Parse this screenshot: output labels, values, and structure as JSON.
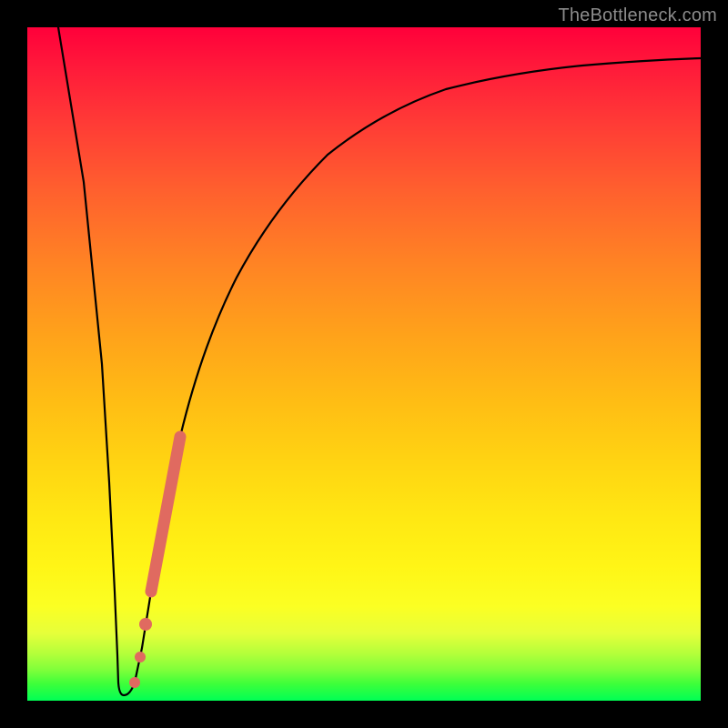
{
  "attribution": "TheBottleneck.com",
  "colors": {
    "frame": "#000000",
    "curve": "#000000",
    "marker": "#e06a60",
    "gradient_top": "#ff003a",
    "gradient_bottom": "#00ff55",
    "attribution_text": "#8c8c8c"
  },
  "chart_data": {
    "type": "line",
    "title": "",
    "xlabel": "",
    "ylabel": "",
    "xlim": [
      0,
      100
    ],
    "ylim": [
      0,
      100
    ],
    "x": [
      5,
      6,
      7,
      8,
      9,
      10,
      11,
      12,
      12.5,
      13,
      13.5,
      14,
      15,
      16,
      17,
      18,
      19,
      20,
      22,
      24,
      26,
      28,
      30,
      33,
      36,
      40,
      45,
      50,
      55,
      60,
      66,
      73,
      80,
      88,
      100
    ],
    "y": [
      100,
      92,
      80,
      68,
      55,
      40,
      25,
      10,
      5,
      2,
      1,
      2,
      6,
      12,
      18,
      24,
      30,
      36,
      46,
      55,
      62,
      68,
      72,
      77,
      80,
      83,
      86,
      88,
      89.5,
      90.7,
      91.8,
      92.8,
      93.6,
      94.4,
      95.3
    ],
    "markers": [
      {
        "x": 14.0,
        "y": 2
      },
      {
        "x": 15.2,
        "y": 7
      },
      {
        "x": 16.0,
        "y": 12
      },
      {
        "x": 17.3,
        "y": 20
      },
      {
        "x": 18.7,
        "y": 28
      },
      {
        "x": 20.0,
        "y": 36
      },
      {
        "x": 21.3,
        "y": 43
      }
    ],
    "note": "Values are approximate readings from an unlabeled gradient plot; y represents bottleneck percentage (0 at bottom/green, 100 at top/red) and x is an unlabeled component-performance axis."
  }
}
